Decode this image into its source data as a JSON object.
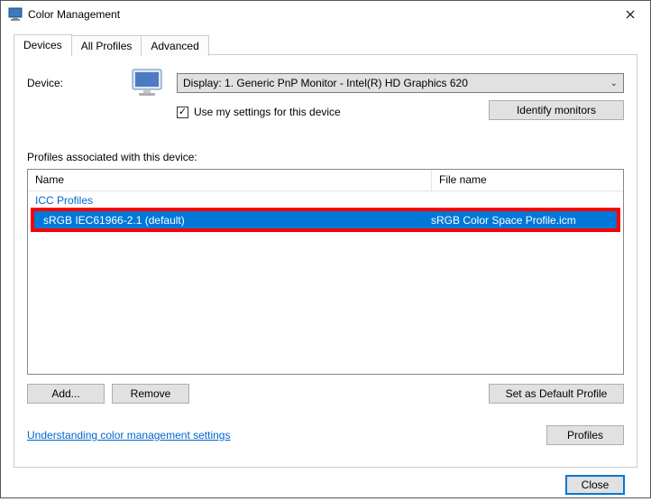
{
  "titlebar": {
    "title": "Color Management"
  },
  "tabs": {
    "devices": "Devices",
    "all": "All Profiles",
    "advanced": "Advanced"
  },
  "device": {
    "label": "Device:",
    "selected": "Display: 1. Generic PnP Monitor - Intel(R) HD Graphics 620",
    "use_my_settings": "Use my settings for this device",
    "identify": "Identify monitors"
  },
  "profiles": {
    "label": "Profiles associated with this device:",
    "col_name": "Name",
    "col_file": "File name",
    "group": "ICC Profiles",
    "row": {
      "name": "sRGB IEC61966-2.1 (default)",
      "file": "sRGB Color Space Profile.icm"
    }
  },
  "actions": {
    "add": "Add...",
    "remove": "Remove",
    "set_default": "Set as Default Profile",
    "profiles_btn": "Profiles",
    "link": "Understanding color management settings",
    "close": "Close"
  }
}
